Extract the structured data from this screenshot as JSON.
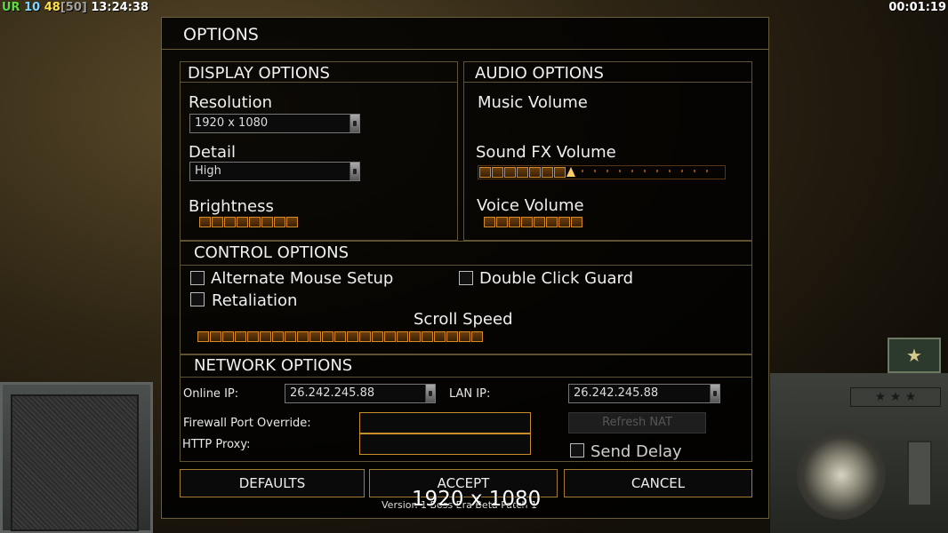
{
  "hud": {
    "tag": "UR",
    "n1": "10",
    "n2": "48",
    "n3": "[50]",
    "clock": "13:24:38",
    "timer": "00:01:19"
  },
  "dialog": {
    "title": "OPTIONS",
    "display": {
      "title": "DISPLAY OPTIONS",
      "resolution_label": "Resolution",
      "resolution_value": "1920 x 1080",
      "detail_label": "Detail",
      "detail_value": "High",
      "brightness_label": "Brightness",
      "brightness_level": 0.3
    },
    "audio": {
      "title": "AUDIO OPTIONS",
      "music_label": "Music Volume",
      "music_level": 0,
      "sfx_label": "Sound FX Volume",
      "sfx_level": 0.4,
      "voice_label": "Voice Volume",
      "voice_level": 0.3
    },
    "control": {
      "title": "CONTROL OPTIONS",
      "alt_mouse_label": "Alternate Mouse Setup",
      "retaliation_label": "Retaliation",
      "double_click_label": "Double Click Guard",
      "scroll_label": "Scroll Speed",
      "scroll_level": 0.6
    },
    "network": {
      "title": "NETWORK OPTIONS",
      "online_ip_label": "Online IP:",
      "online_ip_value": "26.242.245.88",
      "lan_ip_label": "LAN IP:",
      "lan_ip_value": "26.242.245.88",
      "firewall_label": "Firewall Port Override:",
      "http_proxy_label": "HTTP Proxy:",
      "refresh_nat_label": "Refresh NAT",
      "send_delay_label": "Send Delay"
    },
    "buttons": {
      "defaults": "DEFAULTS",
      "accept": "ACCEPT",
      "cancel": "CANCEL"
    },
    "version_text": "Version 1 Boss Era Beta Patch 1",
    "overlay_text": "1920 x 1080"
  },
  "colors": {
    "accent_border": "#a47b33",
    "slider_segment": "#d48a26",
    "panel_border": "#5e5232"
  }
}
